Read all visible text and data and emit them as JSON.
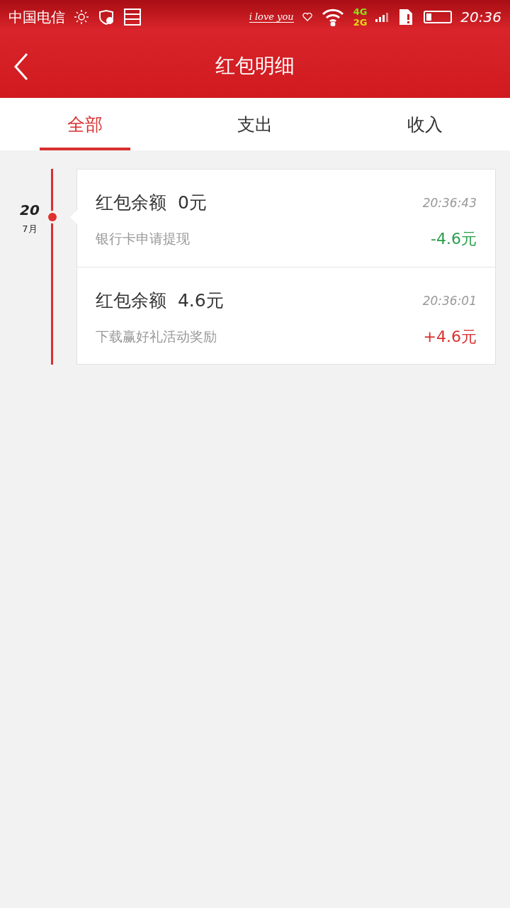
{
  "status_bar": {
    "carrier": "中国电信",
    "signature": "i love you",
    "network_top": "4G",
    "network_bottom": "2G",
    "time": "20:36"
  },
  "header": {
    "title": "红包明细"
  },
  "tabs": [
    {
      "label": "全部",
      "selected": true
    },
    {
      "label": "支出",
      "selected": false
    },
    {
      "label": "收入",
      "selected": false
    }
  ],
  "day": {
    "date": "20",
    "month": "7月"
  },
  "records": [
    {
      "title": "红包余额  0元",
      "time": "20:36:43",
      "description": "银行卡申请提现",
      "amount": "-4.6元",
      "kind": "expense"
    },
    {
      "title": "红包余额  4.6元",
      "time": "20:36:01",
      "description": "下载赢好礼活动奖励",
      "amount": "+4.6元",
      "kind": "income"
    }
  ]
}
